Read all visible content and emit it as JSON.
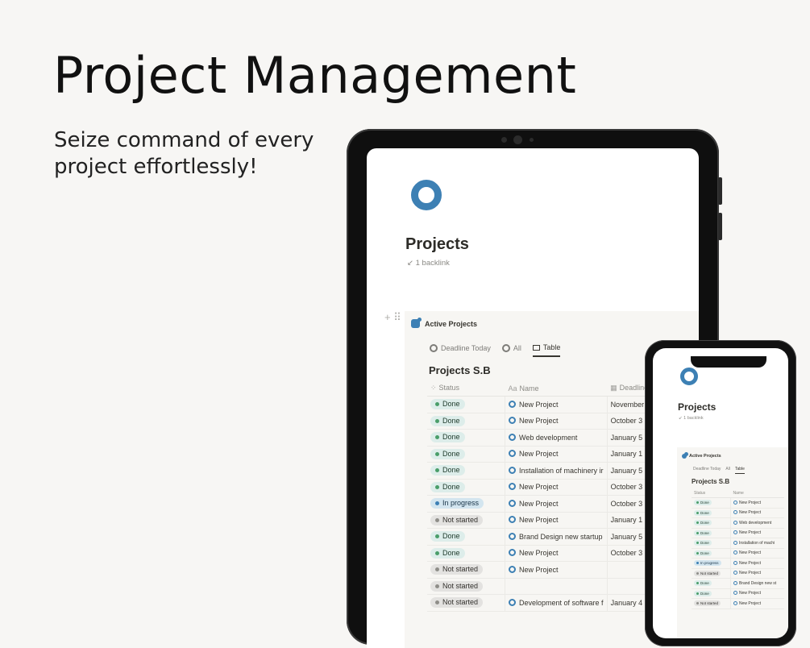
{
  "hero": {
    "title": "Project Management",
    "subtitle": "Seize command of every project effortlessly!"
  },
  "page": {
    "title": "Projects",
    "backlink": "1 backlink",
    "icon": "circle-ring-icon",
    "accent_color": "#3d80b4"
  },
  "database": {
    "name": "Active Projects",
    "views": [
      "Deadline Today",
      "All",
      "Table"
    ],
    "active_view": "Table",
    "table_title": "Projects S.B",
    "columns": [
      "Status",
      "Name",
      "Deadline"
    ],
    "rows": [
      {
        "status": "Done",
        "name": "New Project",
        "deadline": "November"
      },
      {
        "status": "Done",
        "name": "New Project",
        "deadline": "October 3"
      },
      {
        "status": "Done",
        "name": "Web development",
        "deadline": "January 5"
      },
      {
        "status": "Done",
        "name": "New Project",
        "deadline": "January 1"
      },
      {
        "status": "Done",
        "name": "Installation of machinery ir",
        "deadline": "January 5"
      },
      {
        "status": "Done",
        "name": "New Project",
        "deadline": "October 3"
      },
      {
        "status": "In progress",
        "name": "New Project",
        "deadline": "October 3"
      },
      {
        "status": "Not started",
        "name": "New Project",
        "deadline": "January 1"
      },
      {
        "status": "Done",
        "name": "Brand Design new startup",
        "deadline": "January 5"
      },
      {
        "status": "Done",
        "name": "New Project",
        "deadline": "October 3"
      },
      {
        "status": "Not started",
        "name": "New Project",
        "deadline": ""
      },
      {
        "status": "Not started",
        "name": "",
        "deadline": ""
      },
      {
        "status": "Not started",
        "name": "Development of software f",
        "deadline": "January 4"
      }
    ]
  },
  "phone": {
    "columns": [
      "Status",
      "Name"
    ],
    "rows": [
      {
        "status": "Done",
        "name": "New Project"
      },
      {
        "status": "Done",
        "name": "New Project"
      },
      {
        "status": "Done",
        "name": "Web development"
      },
      {
        "status": "Done",
        "name": "New Project"
      },
      {
        "status": "Done",
        "name": "Installation of machi"
      },
      {
        "status": "Done",
        "name": "New Project"
      },
      {
        "status": "In progress",
        "name": "New Project"
      },
      {
        "status": "Not started",
        "name": "New Project"
      },
      {
        "status": "Done",
        "name": "Brand Design new st"
      },
      {
        "status": "Done",
        "name": "New Project"
      },
      {
        "status": "Not started",
        "name": "New Project"
      }
    ]
  },
  "status_colors": {
    "Done": "#ddedea",
    "In progress": "#d3e5ef",
    "Not started": "#e3e2e0"
  }
}
